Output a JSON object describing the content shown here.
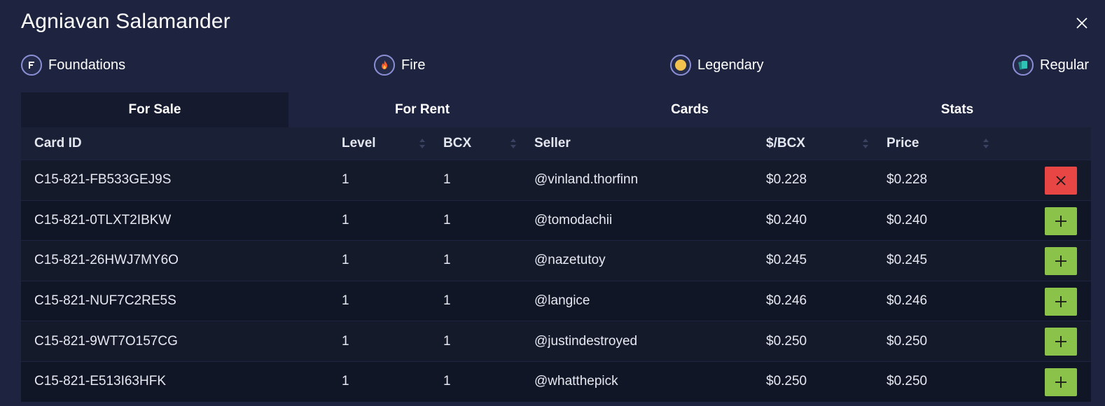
{
  "title": "Agniavan Salamander",
  "attributes": [
    {
      "name": "edition-attr",
      "icon": "foundations-icon",
      "label": "Foundations"
    },
    {
      "name": "element-attr",
      "icon": "fire-icon",
      "label": "Fire"
    },
    {
      "name": "rarity-attr",
      "icon": "legendary-dot-icon",
      "label": "Legendary"
    },
    {
      "name": "foil-attr",
      "icon": "regular-card-icon",
      "label": "Regular"
    }
  ],
  "tabs": [
    "For Sale",
    "For Rent",
    "Cards",
    "Stats"
  ],
  "active_tab": "For Sale",
  "columns": [
    "Card ID",
    "Level",
    "BCX",
    "Seller",
    "$/BCX",
    "Price"
  ],
  "rows": [
    {
      "card_id": "C15-821-FB533GEJ9S",
      "level": "1",
      "bcx": "1",
      "seller": "@vinland.thorfinn",
      "per_bcx": "$0.228",
      "price": "$0.228",
      "action": "remove"
    },
    {
      "card_id": "C15-821-0TLXT2IBKW",
      "level": "1",
      "bcx": "1",
      "seller": "@tomodachii",
      "per_bcx": "$0.240",
      "price": "$0.240",
      "action": "add"
    },
    {
      "card_id": "C15-821-26HWJ7MY6O",
      "level": "1",
      "bcx": "1",
      "seller": "@nazetutoy",
      "per_bcx": "$0.245",
      "price": "$0.245",
      "action": "add"
    },
    {
      "card_id": "C15-821-NUF7C2RE5S",
      "level": "1",
      "bcx": "1",
      "seller": "@langice",
      "per_bcx": "$0.246",
      "price": "$0.246",
      "action": "add"
    },
    {
      "card_id": "C15-821-9WT7O157CG",
      "level": "1",
      "bcx": "1",
      "seller": "@justindestroyed",
      "per_bcx": "$0.250",
      "price": "$0.250",
      "action": "add"
    },
    {
      "card_id": "C15-821-E513I63HFK",
      "level": "1",
      "bcx": "1",
      "seller": "@whatthepick",
      "per_bcx": "$0.250",
      "price": "$0.250",
      "action": "add"
    }
  ],
  "colors": {
    "background": "#1e2440",
    "remove_button": "#e84545",
    "add_button": "#8bc34a",
    "badge_border": "#8b8fd6",
    "legendary": "#f2c14e"
  }
}
